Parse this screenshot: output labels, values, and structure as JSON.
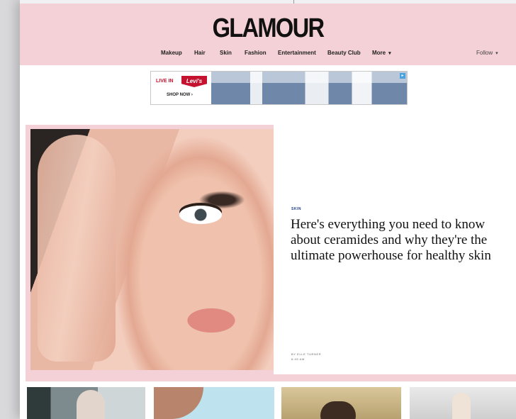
{
  "header": {
    "logo": "GLAMOUR",
    "nav": [
      {
        "label": "Makeup"
      },
      {
        "label": "Hair"
      },
      {
        "label": "Skin"
      },
      {
        "label": "Fashion"
      },
      {
        "label": "Entertainment"
      },
      {
        "label": "Beauty Club"
      },
      {
        "label": "More"
      }
    ],
    "follow_label": "Follow"
  },
  "ad": {
    "live_in": "LIVE IN",
    "brand": "Levi's",
    "cta": "SHOP NOW ›"
  },
  "hero": {
    "category": "SKIN",
    "headline": "Here's everything you need to know about ceramides and why they're the ultimate powerhouse for healthy skin",
    "byline_author": "BY ELLE TURNER",
    "byline_time": "8:45 AM"
  },
  "colors": {
    "header_bg": "#f4d1d6",
    "category_blue": "#1a3a8a",
    "levis_red": "#c4122f"
  }
}
